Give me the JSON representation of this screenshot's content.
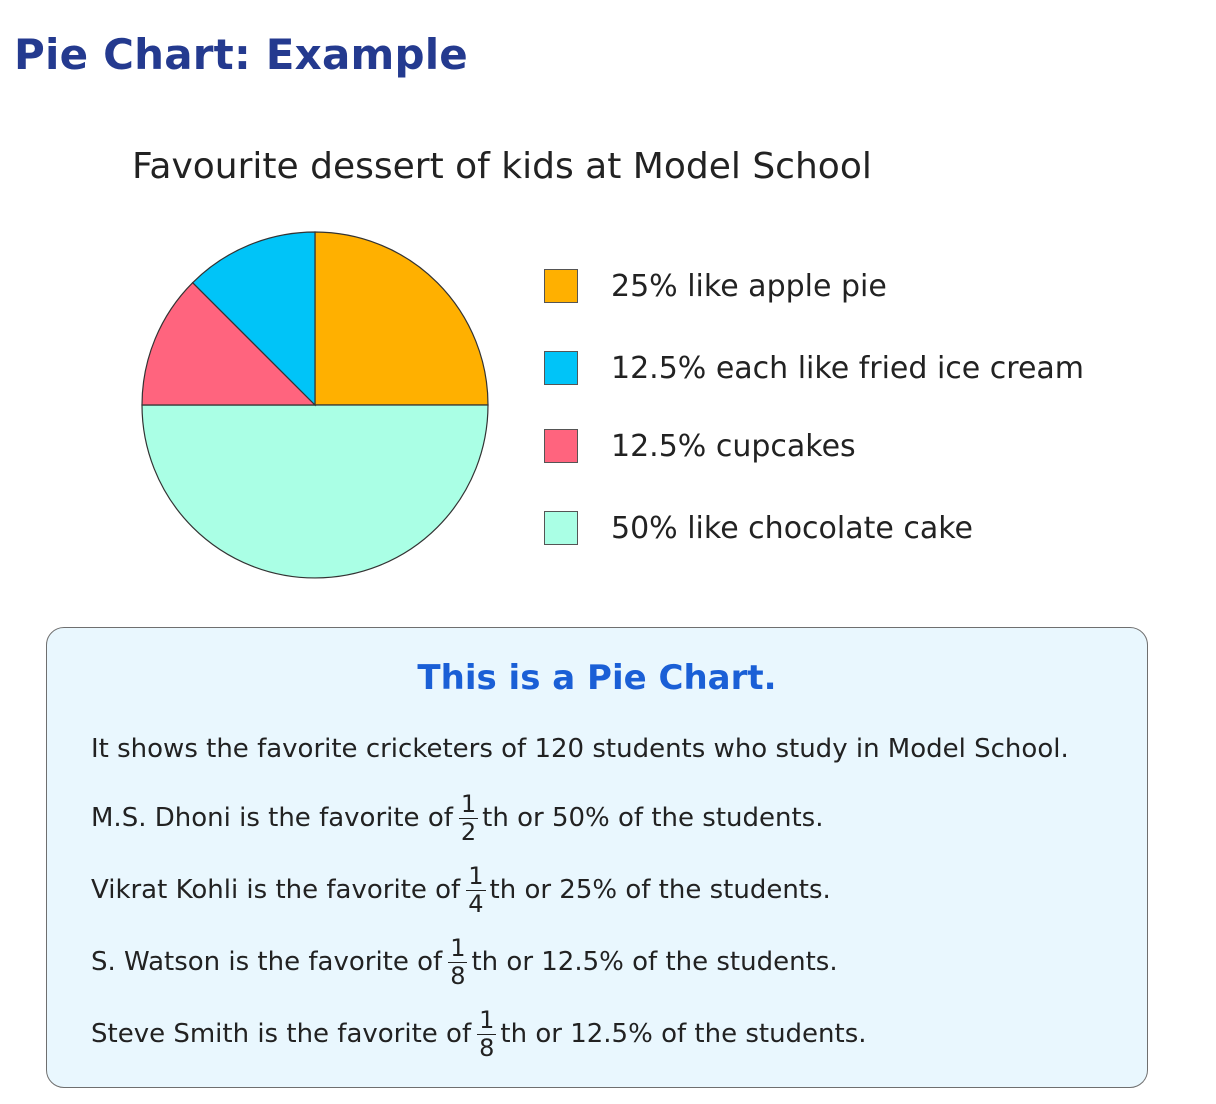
{
  "page": {
    "title": "Pie Chart: Example"
  },
  "chart_data": {
    "type": "pie",
    "title": "Favourite dessert of kids at Model School",
    "slices": [
      {
        "label": "25% like apple pie",
        "value": 25,
        "color": "#FFB000"
      },
      {
        "label": "12.5% each like fried ice cream",
        "value": 12.5,
        "color": "#00C4F8"
      },
      {
        "label": "12.5% cupcakes",
        "value": 12.5,
        "color": "#FF647E"
      },
      {
        "label": "50% like chocolate cake",
        "value": 50,
        "color": "#AAFFE5"
      }
    ],
    "slice_order_clockwise_from_top": [
      "25% like apple pie",
      "50% like chocolate cake",
      "12.5% cupcakes",
      "12.5% each like fried ice cream"
    ],
    "legend_position": "right"
  },
  "info": {
    "heading": "This is a Pie Chart.",
    "intro": "It shows the favorite  cricketers of 120 students who study in Model School.",
    "lines": [
      {
        "before": "M.S. Dhoni is the favorite of",
        "num": "1",
        "den": "2",
        "after": "th  or 50% of the students."
      },
      {
        "before": "Vikrat Kohli is the favorite of",
        "num": "1",
        "den": "4",
        "after": "th or 25% of the students."
      },
      {
        "before": "S. Watson is the favorite of",
        "num": "1",
        "den": "8",
        "after": "th or 12.5% of the students."
      },
      {
        "before": "Steve Smith is the favorite of",
        "num": "1",
        "den": "8",
        "after": "th or 12.5% of the students."
      }
    ]
  }
}
